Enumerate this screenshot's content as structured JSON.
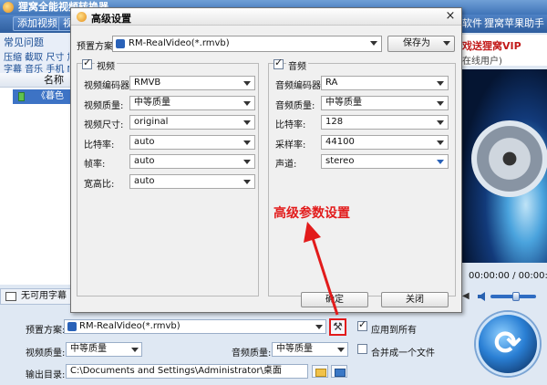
{
  "app": {
    "title": "狸窝全能视频转换器"
  },
  "toolbar": {
    "add_video": "添加视频",
    "btn2": "视",
    "link_software": "软件",
    "link_apple": "狸窝苹果助手"
  },
  "faq": {
    "title": "常见问题",
    "line1": "压缩 截取 尺寸 加",
    "line2": "字幕 音乐 手机 M"
  },
  "file_list": {
    "header": "名称",
    "row": "《暮色"
  },
  "subtitle_bar": {
    "label": "无可用字幕"
  },
  "gift": {
    "line1": "戏送狸窝VIP",
    "line2": "在线用户)"
  },
  "player": {
    "time": "00:00:00 / 00:00:00"
  },
  "bottom": {
    "preset_label": "预置方案:",
    "preset_value": "RM-RealVideo(*.rmvb)",
    "apply_all": "应用到所有",
    "video_quality_label": "视频质量:",
    "video_quality_value": "中等质量",
    "audio_quality_label": "音频质量:",
    "audio_quality_value": "中等质量",
    "merge_label": "合并成一个文件",
    "output_label": "输出目录:",
    "output_path": "C:\\Documents and Settings\\Administrator\\桌面"
  },
  "dialog": {
    "title": "高级设置",
    "close": "×",
    "preset_label": "预置方案:",
    "preset_value": "RM-RealVideo(*.rmvb)",
    "save_as": "保存为",
    "video_group": "视频",
    "audio_group": "音频",
    "video_fields": [
      {
        "label": "视频编码器:",
        "value": "RMVB"
      },
      {
        "label": "视频质量:",
        "value": "中等质量"
      },
      {
        "label": "视频尺寸:",
        "value": "original"
      },
      {
        "label": "比特率:",
        "value": "auto"
      },
      {
        "label": "帧率:",
        "value": "auto"
      },
      {
        "label": "宽高比:",
        "value": "auto"
      }
    ],
    "audio_fields": [
      {
        "label": "音频编码器:",
        "value": "RA"
      },
      {
        "label": "音频质量:",
        "value": "中等质量"
      },
      {
        "label": "比特率:",
        "value": "128"
      },
      {
        "label": "采样率:",
        "value": "44100"
      },
      {
        "label": "声道:",
        "value": "stereo"
      }
    ],
    "annotation": "高级参数设置",
    "ok": "确定",
    "close_button": "关闭"
  },
  "colors": {
    "annotation": "#e21b1b",
    "title_bar": "#3f74b8"
  }
}
